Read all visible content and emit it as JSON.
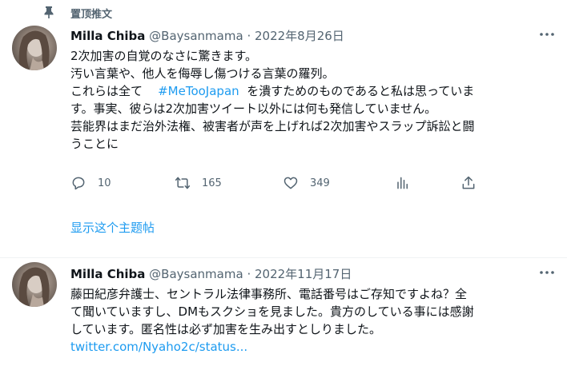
{
  "pinned": {
    "label": "置顶推文",
    "icon": "pin-icon"
  },
  "tweets": [
    {
      "author": {
        "name": "Milla Chiba",
        "handle": "@Baysanmama"
      },
      "dot": "·",
      "date": "2022年8月26日",
      "lines": [
        "2次加害の自覚のなさに驚きます。",
        "汚い言葉や、他人を侮辱し傷つける言葉の羅列。",
        "これらは全て",
        "を潰すためのものであると私は思っていま",
        "す。事実、彼らは2次加害ツイート以外には何も発信していません。",
        "芸能界はまだ治外法権、被害者が声を上げれば2次加害やスラップ訴訟と闘",
        "うことに"
      ],
      "hashtag": "#MeTooJapan",
      "actions": {
        "reply_count": "10",
        "retweet_count": "165",
        "like_count": "349"
      },
      "show_thread": "显示这个主题帖"
    },
    {
      "author": {
        "name": "Milla Chiba",
        "handle": "@Baysanmama"
      },
      "dot": "·",
      "date": "2022年11月17日",
      "lines": [
        "藤田紀彦弁護士、セントラル法律事務所、電話番号はご存知ですよね？全",
        "て聞いていますし、DMもスクショを見ました。貴方のしている事には感謝",
        "しています。匿名性は必ず加害を生み出すとしりました。"
      ],
      "link": "twitter.com/Nyaho2c/status..."
    }
  ],
  "colors": {
    "accent": "#1d9bf0",
    "muted": "#536471",
    "text": "#0f1419"
  }
}
